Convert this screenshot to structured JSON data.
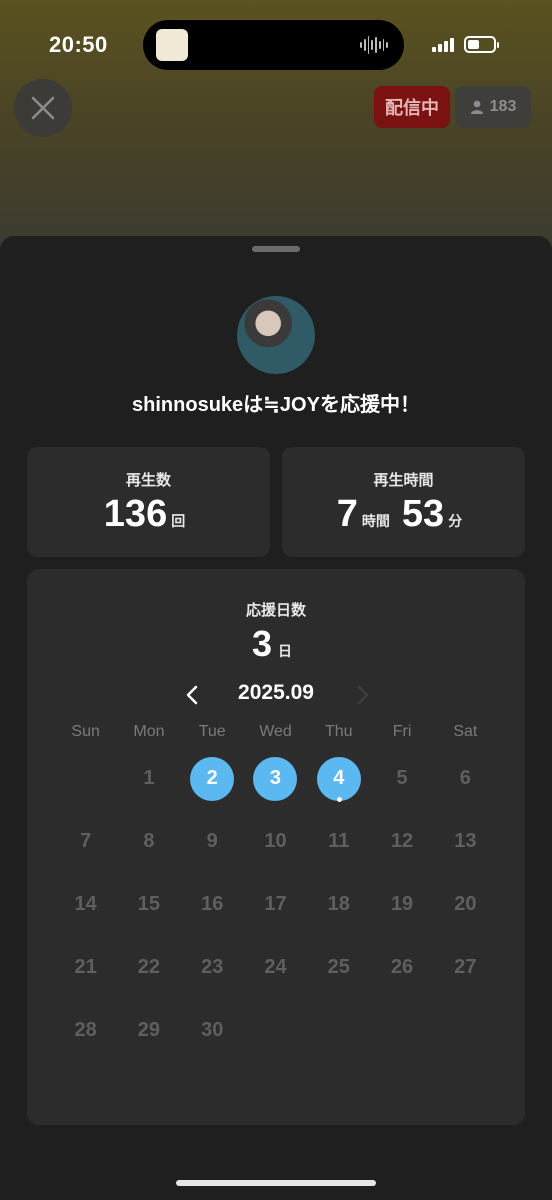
{
  "status_bar": {
    "time": "20:50",
    "battery_level": 0.45
  },
  "header": {
    "live_label": "配信中",
    "viewer_count": "183"
  },
  "sheet": {
    "headline": "shinnosukeは≒JOYを応援中！",
    "stats": {
      "plays": {
        "label": "再生数",
        "value": "136",
        "unit": "回"
      },
      "play_time": {
        "label": "再生時間",
        "hours": "7",
        "hours_unit": "時間",
        "minutes": "53",
        "minutes_unit": "分"
      }
    },
    "calendar": {
      "title": "応援日数",
      "days_value": "3",
      "days_unit": "日",
      "month": "2025.09",
      "weekdays": [
        "Sun",
        "Mon",
        "Tue",
        "Wed",
        "Thu",
        "Fri",
        "Sat"
      ],
      "first_weekday_index": 1,
      "days_in_month": 30,
      "active_days": [
        2,
        3,
        4
      ],
      "today": 4
    }
  },
  "colors": {
    "accent": "#5cb8f0",
    "live_badge": "#7a1212",
    "sheet_bg": "#1f1f1f",
    "card_bg": "#2c2c2c"
  },
  "icons": {
    "close": "close-icon",
    "viewer": "person-icon",
    "prev_month": "chevron-left-icon",
    "next_month": "chevron-right-icon"
  }
}
